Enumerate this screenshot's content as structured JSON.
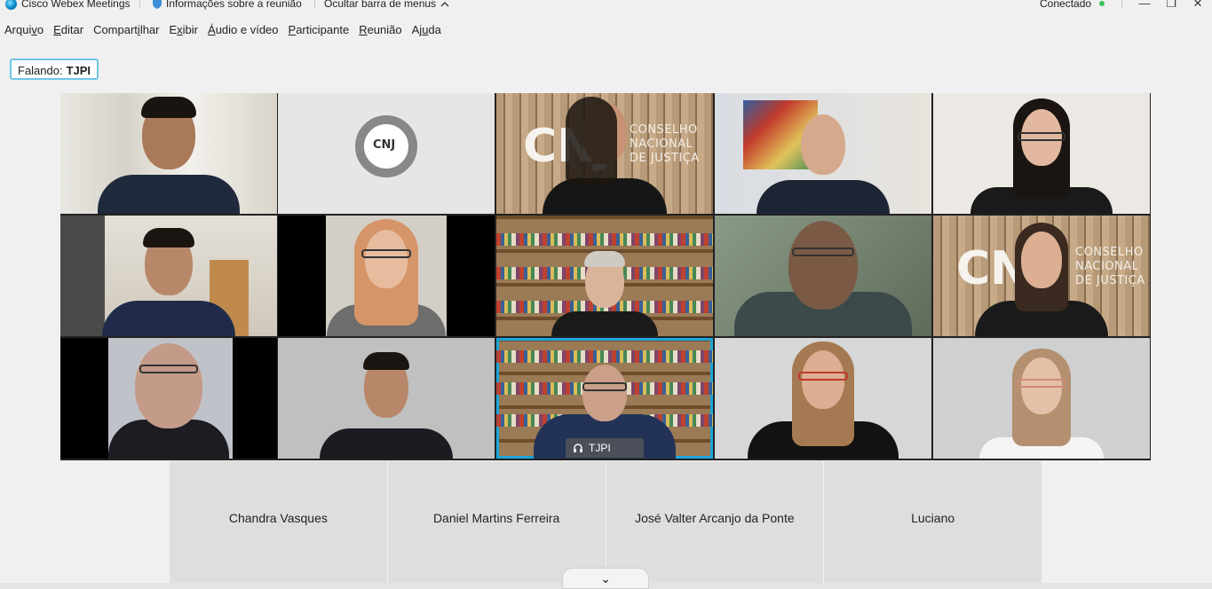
{
  "titlebar": {
    "app_name": "Cisco Webex Meetings",
    "meeting_info": "Informações sobre a reunião",
    "hide_menu": "Ocultar barra de menus",
    "hide_menu_chevron": "^",
    "connection_status": "Conectado",
    "status_color": "#35c25a"
  },
  "menu": [
    {
      "pre": "Arqui",
      "u": "v",
      "post": "o"
    },
    {
      "pre": "",
      "u": "E",
      "post": "ditar"
    },
    {
      "pre": "Compart",
      "u": "i",
      "post": "lhar"
    },
    {
      "pre": "E",
      "u": "x",
      "post": "ibir"
    },
    {
      "pre": "",
      "u": "Á",
      "post": "udio e vídeo"
    },
    {
      "pre": "",
      "u": "P",
      "post": "articipante"
    },
    {
      "pre": "",
      "u": "R",
      "post": "eunião"
    },
    {
      "pre": "Aj",
      "u": "u",
      "post": "da"
    }
  ],
  "speaking": {
    "label": "Falando:",
    "name": "TJPI"
  },
  "active_tile_label": "TJPI",
  "logo_text": "CNJ",
  "wall_text": {
    "line1": "CONSELHO",
    "line2": "NACIONAL",
    "line3": "DE JUSTIÇA"
  },
  "participants_bar": [
    "Chandra Vasques",
    "Daniel Martins Ferreira",
    "José Valter Arcanjo da Ponte",
    "Luciano"
  ],
  "collapse_icon": "⌄",
  "accent_color": "#1ba6d8"
}
